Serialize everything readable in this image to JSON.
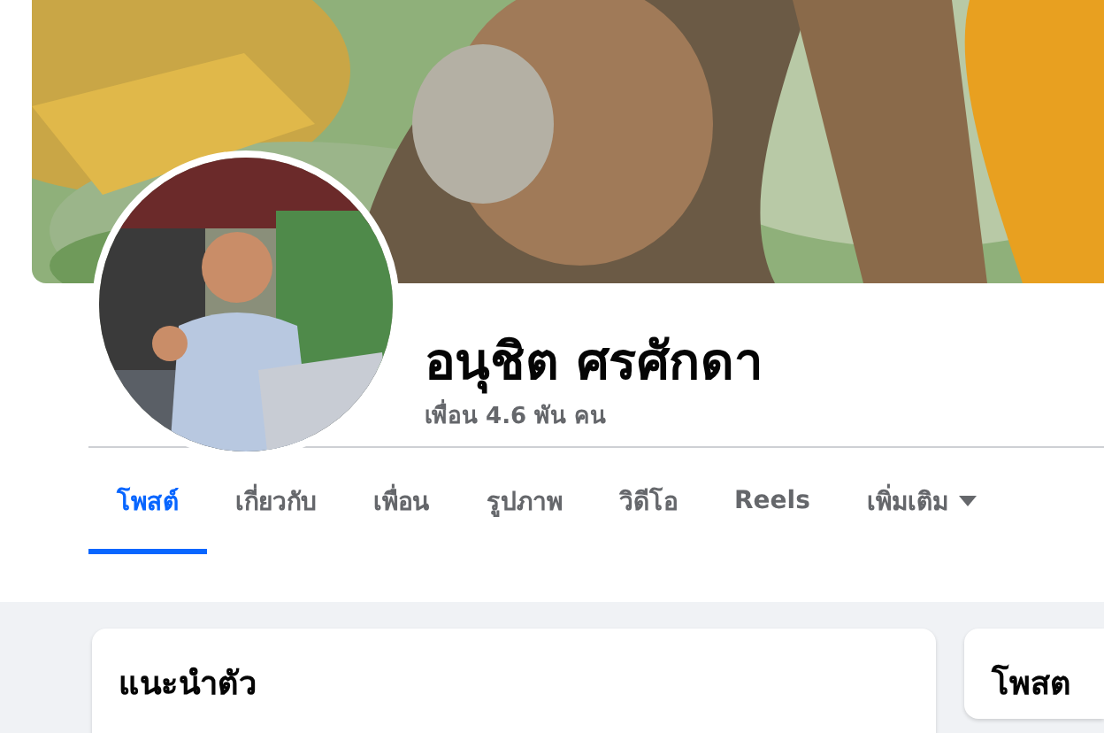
{
  "profile": {
    "name": "อนุชิต ศรศักดา",
    "friends": "เพื่อน 4.6 พัน คน"
  },
  "tabs": [
    {
      "label": "โพสต์",
      "selected": true,
      "kind": "plain"
    },
    {
      "label": "เกี่ยวกับ",
      "selected": false,
      "kind": "plain"
    },
    {
      "label": "เพื่อน",
      "selected": false,
      "kind": "plain"
    },
    {
      "label": "รูปภาพ",
      "selected": false,
      "kind": "plain"
    },
    {
      "label": "วิดีโอ",
      "selected": false,
      "kind": "plain"
    },
    {
      "label": "Reels",
      "selected": false,
      "kind": "plain"
    },
    {
      "label": "เพิ่มเติม",
      "selected": false,
      "kind": "menu"
    }
  ],
  "cards": [
    {
      "title": "แนะนำตัว"
    },
    {
      "title": "โพสต"
    }
  ]
}
